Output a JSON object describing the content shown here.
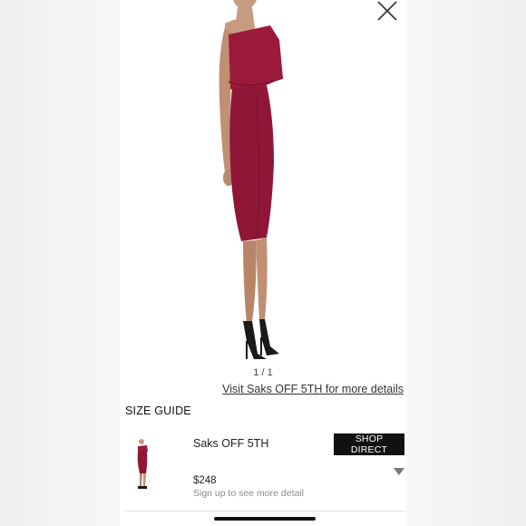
{
  "gallery": {
    "counter": "1 / 1",
    "visit_link": "Visit Saks OFF 5TH for more details"
  },
  "size_guide": {
    "label": "SIZE GUIDE"
  },
  "store": {
    "name": "Saks OFF 5TH",
    "shop_button": "SHOP DIRECT",
    "price": "$248",
    "signup_text": "Sign up to see more detail"
  },
  "colors": {
    "dress": "#9b1a3a",
    "button_bg": "#111111",
    "muted_text": "#8a8a8a"
  },
  "icons": [
    "close-icon",
    "caret-down-icon"
  ]
}
